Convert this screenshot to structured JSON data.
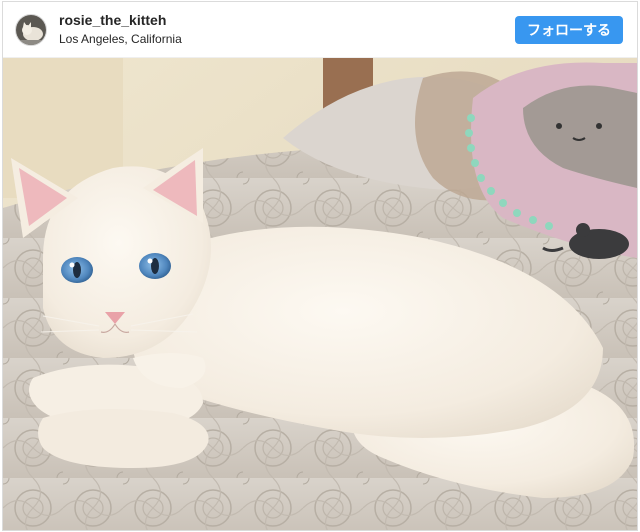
{
  "header": {
    "username": "rosie_the_kitteh",
    "location": "Los Angeles, California",
    "follow_label": "フォローする",
    "avatar_icon": "cat-avatar-icon"
  },
  "photo": {
    "description_icon": "cat-photo",
    "colors": {
      "wall": "#ede3cb",
      "bedspread": "#d7d1c9",
      "cat_fur": "#f7f0e6",
      "cat_eye": "#5d93c7",
      "pillow": "#d9b7c4",
      "pom": "#8fd7bd"
    }
  },
  "colors": {
    "accent": "#3897f0",
    "border": "#dbdbdb"
  }
}
